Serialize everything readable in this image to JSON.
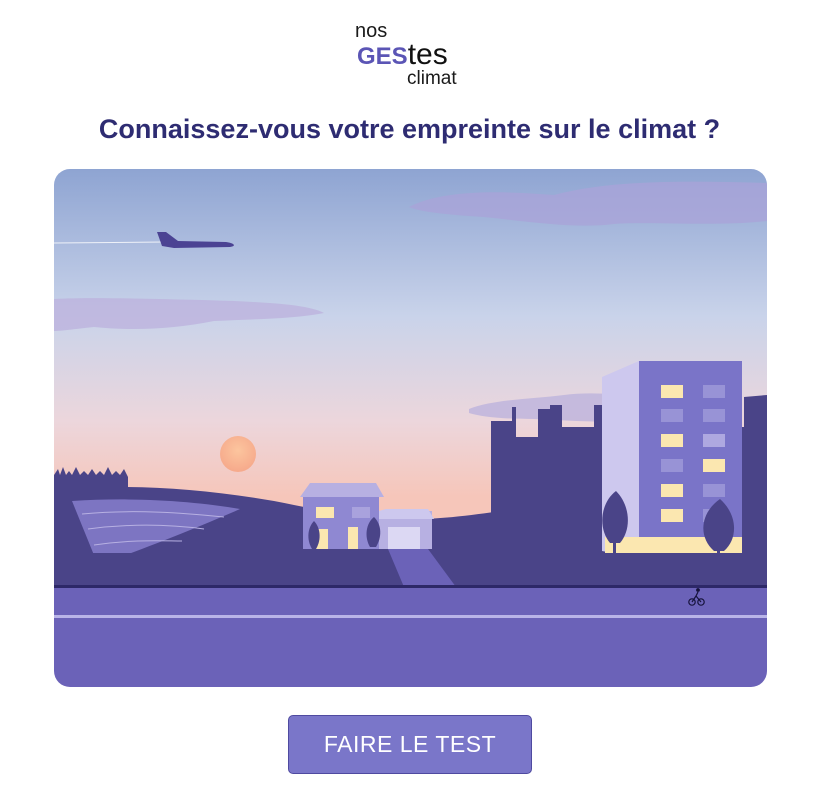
{
  "logo": {
    "line1": "nos",
    "ges": "GES",
    "tes": "tes",
    "line3": "climat"
  },
  "headline": "Connaissez-vous votre empreinte sur le climat ?",
  "illustration": {
    "sky_top_color": "#8ea4d2",
    "sky_horizon_color": "#f6c6ba",
    "ground_color": "#4a4488",
    "road_color": "#6b62b8",
    "window_light_color": "#fbe7b0"
  },
  "cta": {
    "label": "FAIRE LE TEST",
    "color": "#7a76c9"
  }
}
